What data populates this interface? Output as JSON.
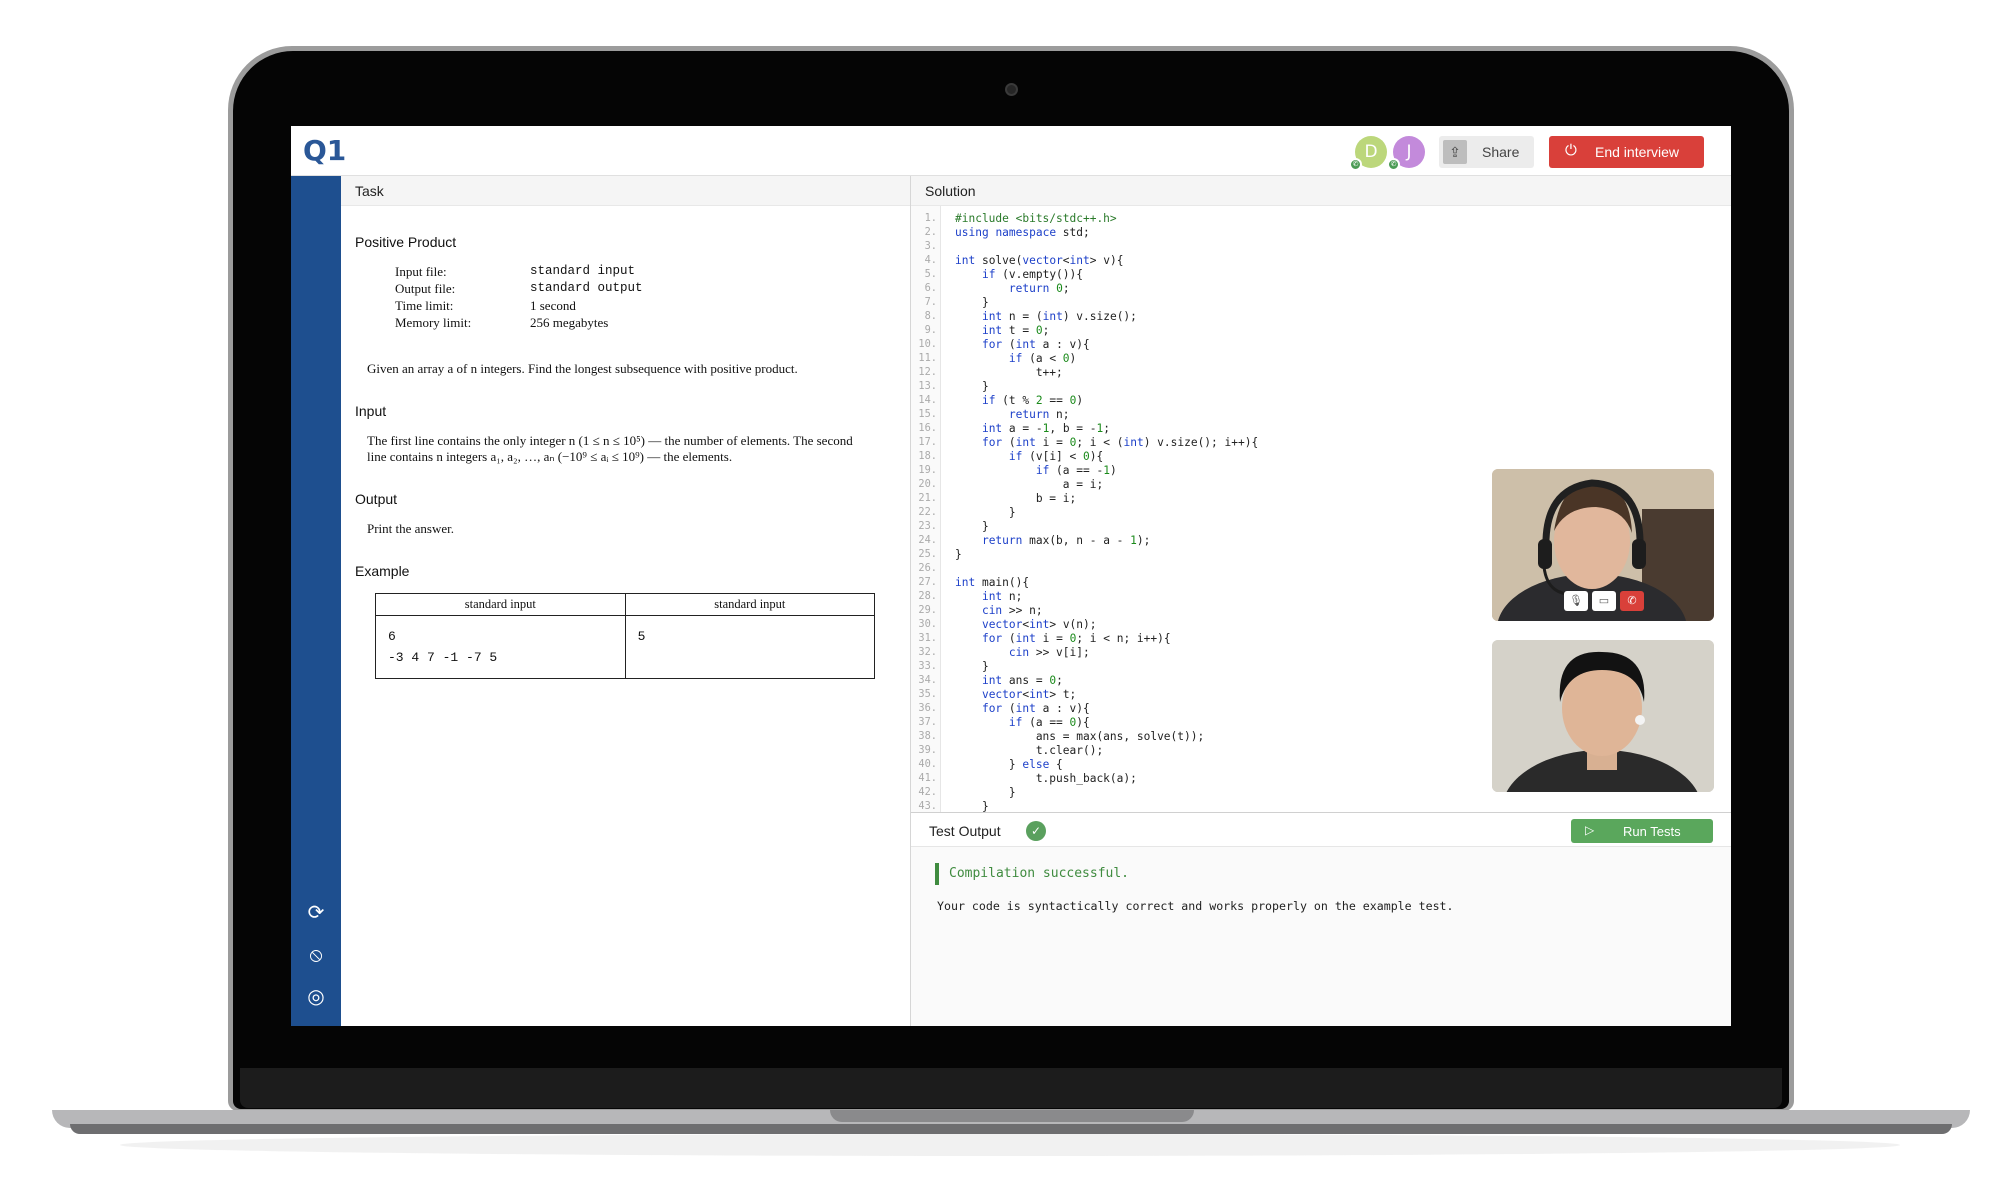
{
  "header": {
    "logo": "Q1",
    "participants": [
      "D",
      "J"
    ],
    "share_label": "Share",
    "end_label": "End interview"
  },
  "task": {
    "pane_title": "Task",
    "title": "Positive Product",
    "limits": [
      {
        "label": "Input file:",
        "value": "standard input"
      },
      {
        "label": "Output file:",
        "value": "standard output"
      },
      {
        "label": "Time limit:",
        "value": "1 second"
      },
      {
        "label": "Memory limit:",
        "value": "256 megabytes"
      }
    ],
    "statement": "Given an array a of n integers. Find the longest subsequence with positive product.",
    "input_heading": "Input",
    "input_text": "The first line contains the only integer n (1 ≤ n ≤ 10⁵) — the number of elements. The second line contains n integers a₁, a₂, …, aₙ (−10⁹ ≤ aᵢ ≤ 10⁹) — the elements.",
    "output_heading": "Output",
    "output_text": "Print the answer.",
    "example_heading": "Example",
    "example": {
      "headers": [
        "standard input",
        "standard input"
      ],
      "input": "6\n-3 4 7 -1 -7 5",
      "output": "5"
    }
  },
  "solution": {
    "pane_title": "Solution",
    "code": [
      "#include <bits/stdc++.h>",
      "using namespace std;",
      "",
      "int solve(vector<int> v){",
      "    if (v.empty()){",
      "        return 0;",
      "    }",
      "    int n = (int) v.size();",
      "    int t = 0;",
      "    for (int a : v){",
      "        if (a < 0)",
      "            t++;",
      "    }",
      "    if (t % 2 == 0)",
      "        return n;",
      "    int a = -1, b = -1;",
      "    for (int i = 0; i < (int) v.size(); i++){",
      "        if (v[i] < 0){",
      "            if (a == -1)",
      "                a = i;",
      "            b = i;",
      "        }",
      "    }",
      "    return max(b, n - a - 1);",
      "}",
      "",
      "int main(){",
      "    int n;",
      "    cin >> n;",
      "    vector<int> v(n);",
      "    for (int i = 0; i < n; i++){",
      "        cin >> v[i];",
      "    }",
      "    int ans = 0;",
      "    vector<int> t;",
      "    for (int a : v){",
      "        if (a == 0){",
      "            ans = max(ans, solve(t));",
      "            t.clear();",
      "        } else {",
      "            t.push_back(a);",
      "        }",
      "    }"
    ]
  },
  "output": {
    "title": "Test Output",
    "run_label": "Run Tests",
    "compile_status": "Compilation successful.",
    "message": "Your code is syntactically correct and works properly on the example test."
  },
  "colors": {
    "brand": "#1e4f8f",
    "danger": "#d9403a",
    "success": "#5aa75c"
  },
  "icons": [
    "refresh-icon",
    "mute-icon",
    "hide-icon",
    "upload-icon",
    "power-icon",
    "play-icon",
    "check-icon",
    "mic-icon",
    "camera-icon",
    "hangup-icon",
    "phone-icon"
  ]
}
